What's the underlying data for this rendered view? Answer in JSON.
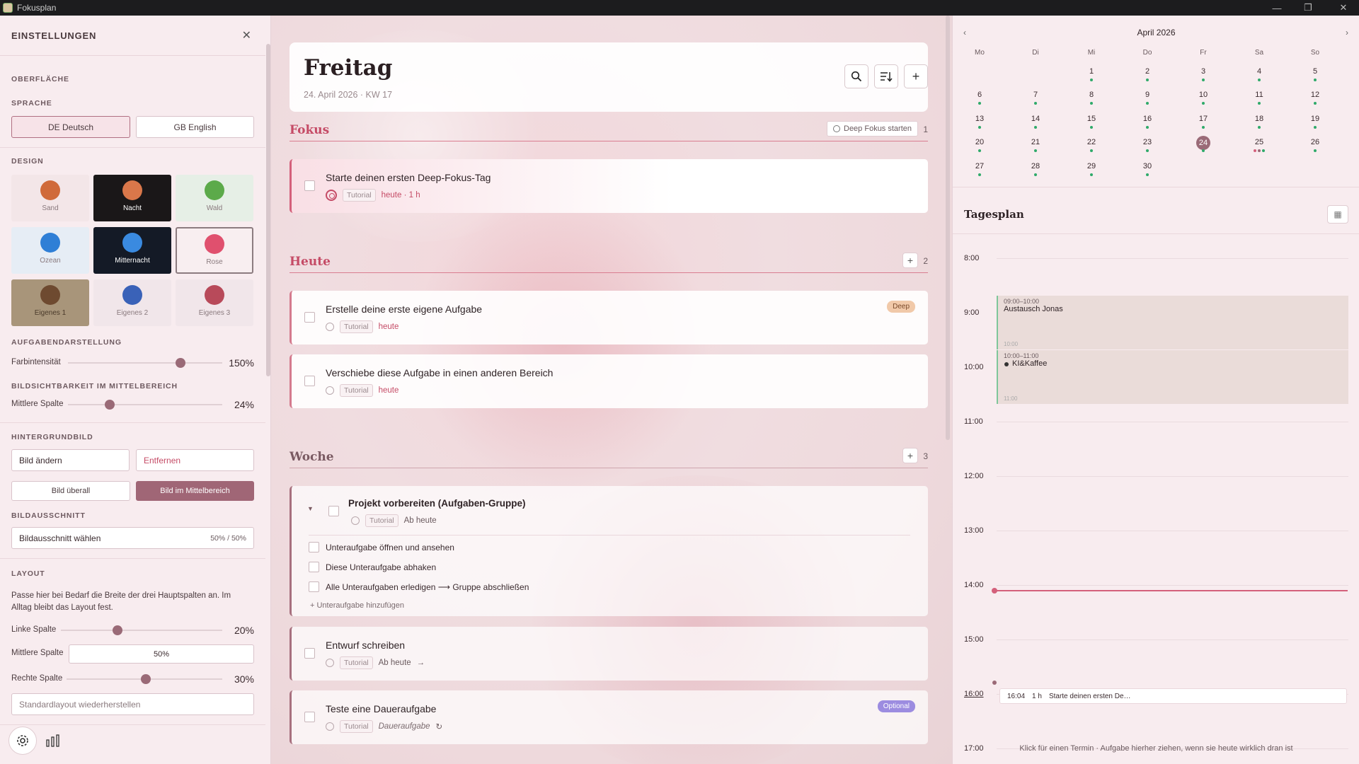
{
  "window": {
    "title": "Fokusplan"
  },
  "settings": {
    "title": "EINSTELLUNGEN",
    "surface_title": "OBERFLÄCHE",
    "language_title": "SPRACHE",
    "lang_de": "DE Deutsch",
    "lang_en": "GB English",
    "design_title": "DESIGN",
    "themes": [
      {
        "label": "Sand",
        "color": "#d06a3a"
      },
      {
        "label": "Nacht",
        "color": "#d9774a"
      },
      {
        "label": "Wald",
        "color": "#5caa4a"
      },
      {
        "label": "Ozean",
        "color": "#2f7fd6"
      },
      {
        "label": "Mitternacht",
        "color": "#3a8ae0"
      },
      {
        "label": "Rose",
        "color": "#e0506e"
      },
      {
        "label": "Eigenes 1",
        "color": "#6e4a30"
      },
      {
        "label": "Eigenes 2",
        "color": "#3a62b8"
      },
      {
        "label": "Eigenes 3",
        "color": "#b84a5a"
      }
    ],
    "task_display_title": "AUFGABENDARSTELLUNG",
    "color_intensity_label": "Farbintensität",
    "color_intensity_value": "150%",
    "image_visibility_title": "BILDSICHTBARKEIT IM MITTELBEREICH",
    "mid_column_label": "Mittlere Spalte",
    "mid_column_value": "24%",
    "background_title": "HINTERGRUNDBILD",
    "change_image": "Bild ändern",
    "remove": "Entfernen",
    "image_everywhere": "Bild überall",
    "image_center": "Bild im Mittelbereich",
    "crop_title": "BILDAUSSCHNITT",
    "crop_label": "Bildausschnitt wählen",
    "crop_value": "50% / 50%",
    "layout_title": "LAYOUT",
    "layout_desc": "Passe hier bei Bedarf die Breite der drei Hauptspalten an. Im Alltag bleibt das Layout fest.",
    "left_col_label": "Linke Spalte",
    "left_col_value": "20%",
    "mid_col_label": "Mittlere Spalte",
    "mid_col_value": "50%",
    "right_col_label": "Rechte Spalte",
    "right_col_value": "30%",
    "reset_layout": "Standardlayout wiederherstellen"
  },
  "header": {
    "day": "Freitag",
    "date": "24. April 2026 · KW 17"
  },
  "sections": {
    "focus": {
      "name": "Fokus",
      "count": "1",
      "deep_button": "Deep Fokus starten"
    },
    "today": {
      "name": "Heute",
      "count": "2"
    },
    "week": {
      "name": "Woche",
      "count": "3"
    }
  },
  "tasks": {
    "focus1": {
      "title": "Starte deinen ersten Deep-Fokus-Tag",
      "tag": "Tutorial",
      "when": "heute · 1 h"
    },
    "today1": {
      "title": "Erstelle deine erste eigene Aufgabe",
      "tag": "Tutorial",
      "when": "heute",
      "badge": "Deep"
    },
    "today2": {
      "title": "Verschiebe diese Aufgabe in einen anderen Bereich",
      "tag": "Tutorial",
      "when": "heute"
    },
    "group": {
      "title": "Projekt vorbereiten (Aufgaben-Gruppe)",
      "tag": "Tutorial",
      "when": "Ab heute",
      "subtasks": [
        "Unteraufgabe öffnen und ansehen",
        "Diese Unteraufgabe abhaken",
        "Alle Unteraufgaben erledigen ⟶ Gruppe abschließen"
      ],
      "add_sub": "+ Unteraufgabe hinzufügen"
    },
    "draft": {
      "title": "Entwurf schreiben",
      "tag": "Tutorial",
      "when": "Ab heute",
      "arrow": "→"
    },
    "recurring": {
      "title": "Teste eine Daueraufgabe",
      "tag": "Tutorial",
      "when": "Daueraufgabe",
      "badge": "Optional",
      "repeat": "↻"
    }
  },
  "calendar": {
    "month": "April 2026",
    "prev": "‹",
    "next": "›",
    "weekdays": [
      "Mo",
      "Di",
      "Mi",
      "Do",
      "Fr",
      "Sa",
      "So"
    ],
    "today": "24"
  },
  "dayplan": {
    "title": "Tagesplan",
    "hours": [
      "8:00",
      "9:00",
      "10:00",
      "11:00",
      "12:00",
      "13:00",
      "14:00",
      "15:00",
      "16:00",
      "17:00"
    ],
    "event1": {
      "time": "09:00–10:00",
      "title": "Austausch Jonas",
      "end": "10:00"
    },
    "event2": {
      "time": "10:00–11:00",
      "title": "KI&Kaffee",
      "end": "11:00"
    },
    "mini_task": {
      "time": "16:04",
      "duration": "1 h",
      "title": "Starte deinen ersten De…"
    },
    "hint": "Klick für einen Termin · Aufgabe hierher ziehen, wenn sie heute wirklich dran ist"
  }
}
